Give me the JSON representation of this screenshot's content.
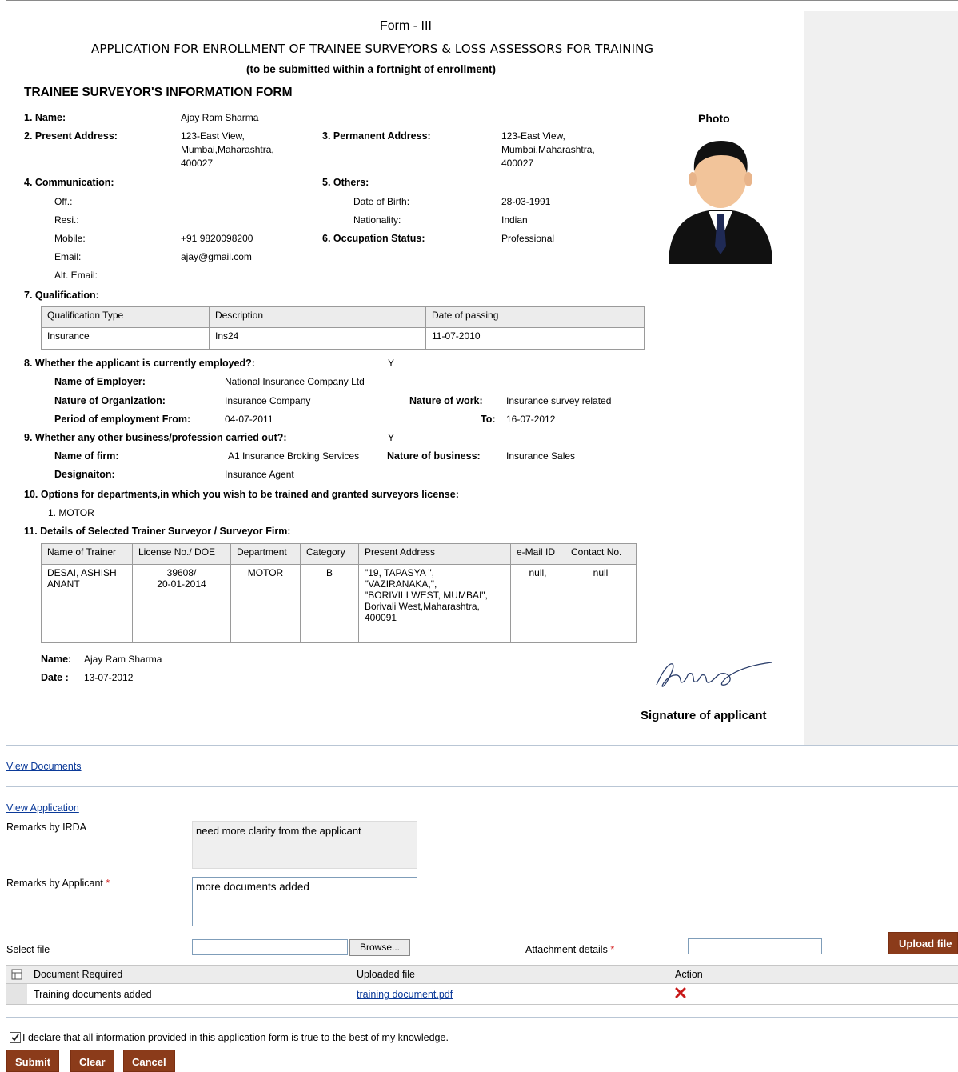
{
  "form": {
    "form_no": "Form - III",
    "title": "APPLICATION FOR ENROLLMENT OF TRAINEE SURVEYORS & LOSS ASSESSORS FOR TRAINING",
    "subtitle": "(to be submitted within a fortnight of enrollment)",
    "section_title": "TRAINEE SURVEYOR'S INFORMATION FORM",
    "photo_label": "Photo",
    "name_label": "1. Name:",
    "name": "Ajay Ram Sharma",
    "present_address_label": "2. Present Address:",
    "present_address": [
      "123-East View,",
      "Mumbai,Maharashtra,",
      "400027"
    ],
    "permanent_address_label": "3. Permanent Address:",
    "permanent_address": [
      "123-East View,",
      "Mumbai,Maharashtra,",
      "400027"
    ],
    "communication_label": "4. Communication:",
    "off_label": "Off.:",
    "resi_label": "Resi.:",
    "mobile_label": "Mobile:",
    "mobile": "+91 9820098200",
    "email_label": "Email:",
    "email": "ajay@gmail.com",
    "alt_email_label": "Alt. Email:",
    "others_label": "5. Others:",
    "dob_label": "Date of Birth:",
    "dob": "28-03-1991",
    "nationality_label": "Nationality:",
    "nationality": "Indian",
    "occupation_label": "6. Occupation Status:",
    "occupation": "Professional",
    "qualification_label": "7. Qualification:",
    "qualification_headers": [
      "Qualification Type",
      "Description",
      "Date of passing"
    ],
    "qualification_rows": [
      [
        "Insurance",
        "Ins24",
        "11-07-2010"
      ]
    ],
    "employed_label": "8. Whether the applicant is currently employed?:",
    "employed": "Y",
    "employer_label": "Name of Employer:",
    "employer": "National Insurance Company Ltd",
    "org_nature_label": "Nature of Organization:",
    "org_nature": "Insurance Company",
    "work_nature_label": "Nature of work:",
    "work_nature": "Insurance survey related",
    "period_from_label": "Period of employment From:",
    "period_from": "04-07-2011",
    "period_to_label": "To:",
    "period_to": "16-07-2012",
    "other_business_label": "9. Whether any other business/profession carried out?:",
    "other_business": "Y",
    "firm_label": "Name of firm:",
    "firm": "A1 Insurance Broking Services",
    "business_nature_label": "Nature of business:",
    "business_nature": "Insurance Sales",
    "designation_label": "Designaiton:",
    "designation": "Insurance Agent",
    "departments_label": "10. Options for departments,in which you wish to be trained and granted surveyors license:",
    "departments": [
      "1. MOTOR"
    ],
    "trainer_label": "11. Details of Selected Trainer Surveyor / Surveyor Firm:",
    "trainer_headers": [
      "Name of Trainer",
      "License No./ DOE",
      "Department",
      "Category",
      "Present Address",
      "e-Mail ID",
      "Contact No."
    ],
    "trainer_row": {
      "name": [
        "DESAI, ASHISH",
        "ANANT"
      ],
      "license": [
        "39608/",
        "20-01-2014"
      ],
      "department": "MOTOR",
      "category": "B",
      "address": [
        "\"19, TAPASYA \",",
        "\"VAZIRANAKA,\",",
        "\"BORIVILI WEST,  MUMBAI\",",
        "Borivali West,Maharashtra,",
        "400091"
      ],
      "email": "null,",
      "contact": "null"
    },
    "footer_name_label": "Name:",
    "footer_name": "Ajay Ram Sharma",
    "footer_date_label": "Date :",
    "footer_date": "13-07-2012",
    "signature_label": "Signature of applicant"
  },
  "links": {
    "view_documents": "View Documents",
    "view_application": "View Application"
  },
  "remarks": {
    "irda_label": "Remarks by IRDA",
    "irda_value": "need more clarity from the applicant",
    "applicant_label": "Remarks by Applicant",
    "applicant_value": "more documents added",
    "required_mark": "*"
  },
  "upload": {
    "select_file_label": "Select file",
    "file_value": "",
    "browse_label": "Browse...",
    "attachment_label": "Attachment details",
    "attachment_value": "",
    "upload_button": "Upload file"
  },
  "documents": {
    "headers": [
      "Document Required",
      "Uploaded file",
      "Action"
    ],
    "rows": [
      {
        "required": "Training documents added",
        "file": "training document.pdf"
      }
    ]
  },
  "declaration": {
    "checked": true,
    "text": "I declare that all information provided in this application form is true to the best of my knowledge."
  },
  "actions": {
    "submit": "Submit",
    "clear": "Clear",
    "cancel": "Cancel"
  },
  "colors": {
    "button_brown": "#8b3b1a",
    "link_blue": "#0b3a99",
    "required_red": "#d42020",
    "delete_red": "#c81818"
  }
}
